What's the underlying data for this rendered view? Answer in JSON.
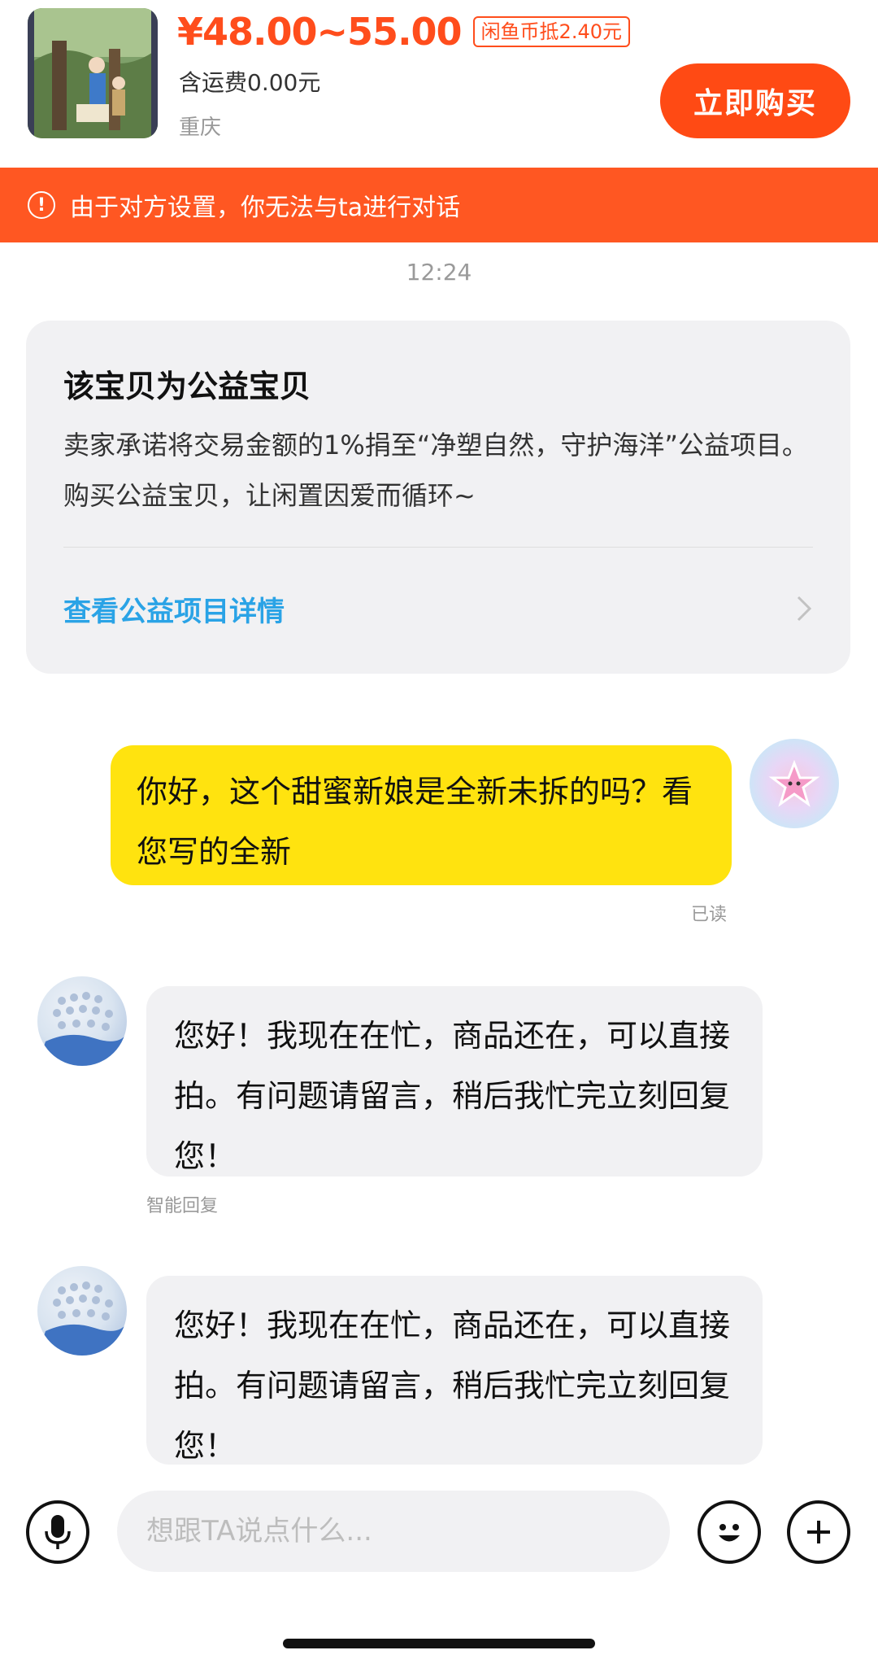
{
  "product": {
    "price": "¥48.00~55.00",
    "coin_badge": "闲鱼币抵2.40元",
    "shipping": "含运费0.00元",
    "location": "重庆",
    "buy_label": "立即购买"
  },
  "warning": {
    "icon": "alert-circle-icon",
    "text": "由于对方设置，你无法与ta进行对话"
  },
  "timestamp": "12:24",
  "charity_card": {
    "title": "该宝贝为公益宝贝",
    "description": "卖家承诺将交易金额的1%捐至“净塑自然，守护海洋”公益项目。购买公益宝贝，让闲置因爱而循环~",
    "link_label": "查看公益项目详情"
  },
  "messages": [
    {
      "from": "me",
      "text": "你好，这个甜蜜新娘是全新未拆的吗？看您写的全新",
      "status": "已读"
    },
    {
      "from": "seller",
      "text": "您好！我现在在忙，商品还在，可以直接拍。有问题请留言，稍后我忙完立刻回复您！",
      "label": "智能回复"
    },
    {
      "from": "seller",
      "text": "您好！我现在在忙，商品还在，可以直接拍。有问题请留言，稍后我忙完立刻回复您！"
    }
  ],
  "input": {
    "placeholder": "想跟TA说点什么..."
  },
  "colors": {
    "accent": "#ff4a14",
    "banner": "#ff5722",
    "my_bubble": "#ffe30f",
    "link": "#2aa3e6"
  }
}
